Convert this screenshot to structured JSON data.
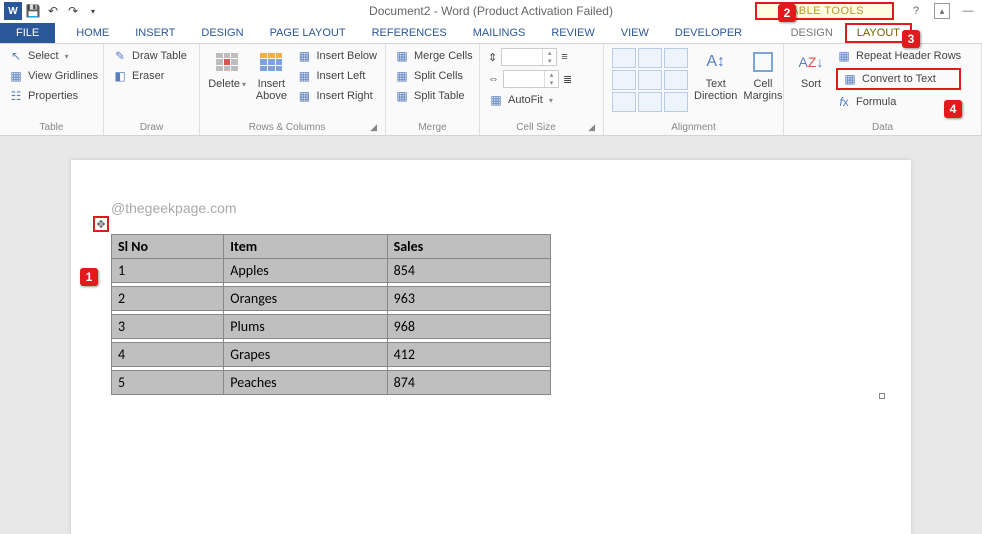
{
  "title": "Document2 - Word (Product Activation Failed)",
  "table_tools_label": "TABLE TOOLS",
  "tabs": {
    "file": "FILE",
    "home": "HOME",
    "insert": "INSERT",
    "design": "DESIGN",
    "page_layout": "PAGE LAYOUT",
    "references": "REFERENCES",
    "mailings": "MAILINGS",
    "review": "REVIEW",
    "view": "VIEW",
    "developer": "DEVELOPER",
    "tt_design": "DESIGN",
    "tt_layout": "LAYOUT"
  },
  "ribbon": {
    "table": {
      "select": "Select",
      "gridlines": "View Gridlines",
      "properties": "Properties",
      "label": "Table"
    },
    "draw": {
      "draw_table": "Draw Table",
      "eraser": "Eraser",
      "label": "Draw"
    },
    "rows_cols": {
      "delete": "Delete",
      "insert_above": "Insert Above",
      "insert_below": "Insert Below",
      "insert_left": "Insert Left",
      "insert_right": "Insert Right",
      "label": "Rows & Columns"
    },
    "merge": {
      "merge_cells": "Merge Cells",
      "split_cells": "Split Cells",
      "split_table": "Split Table",
      "label": "Merge"
    },
    "cell_size": {
      "autofit": "AutoFit",
      "label": "Cell Size"
    },
    "alignment": {
      "text_direction": "Text Direction",
      "cell_margins": "Cell Margins",
      "label": "Alignment"
    },
    "data": {
      "sort": "Sort",
      "repeat_header": "Repeat Header Rows",
      "convert_text": "Convert to Text",
      "formula": "Formula",
      "label": "Data"
    }
  },
  "callouts": {
    "n1": "1",
    "n2": "2",
    "n3": "3",
    "n4": "4"
  },
  "document": {
    "watermark": "@thegeekpage.com",
    "headers": {
      "slno": "Sl No",
      "item": "Item",
      "sales": "Sales"
    },
    "rows": [
      {
        "slno": "1",
        "item": "Apples",
        "sales": "854"
      },
      {
        "slno": "2",
        "item": "Oranges",
        "sales": "963"
      },
      {
        "slno": "3",
        "item": "Plums",
        "sales": "968"
      },
      {
        "slno": "4",
        "item": "Grapes",
        "sales": "412"
      },
      {
        "slno": "5",
        "item": "Peaches",
        "sales": "874"
      }
    ]
  },
  "chart_data": {
    "type": "table",
    "headers": [
      "Sl No",
      "Item",
      "Sales"
    ],
    "rows": [
      [
        1,
        "Apples",
        854
      ],
      [
        2,
        "Oranges",
        963
      ],
      [
        3,
        "Plums",
        968
      ],
      [
        4,
        "Grapes",
        412
      ],
      [
        5,
        "Peaches",
        874
      ]
    ]
  }
}
